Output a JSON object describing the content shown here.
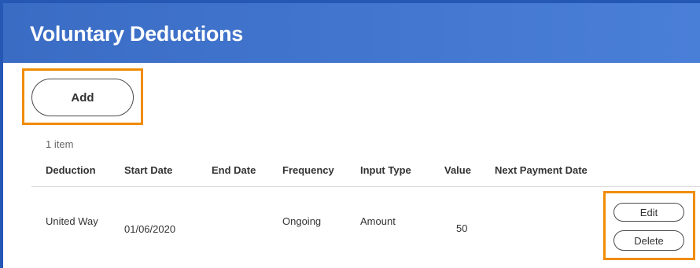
{
  "header": {
    "title": "Voluntary Deductions"
  },
  "toolbar": {
    "add_label": "Add"
  },
  "table": {
    "count": "1 item",
    "columns": [
      "Deduction",
      "Start Date",
      "End Date",
      "Frequency",
      "Input Type",
      "Value",
      "Next Payment Date"
    ],
    "rows": [
      {
        "deduction": "United Way",
        "start_date": "01/06/2020",
        "end_date": "",
        "frequency": "Ongoing",
        "input_type": "Amount",
        "value": "50",
        "next_payment_date": "",
        "edit_label": "Edit",
        "delete_label": "Delete"
      }
    ]
  },
  "colors": {
    "header": "#3a6cc4",
    "highlight": "#f08c00"
  }
}
